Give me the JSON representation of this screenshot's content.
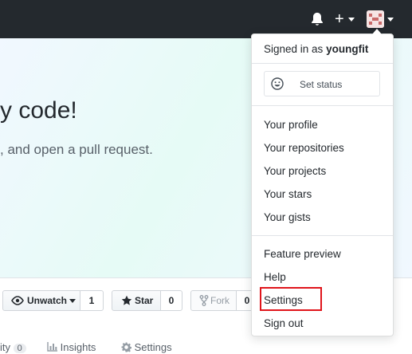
{
  "hero": {
    "heading": "y code!",
    "subtext": ", and open a pull request."
  },
  "repo_actions": {
    "unwatch_label": "Unwatch",
    "watch_count": "1",
    "star_label": "Star",
    "star_count": "0",
    "fork_label": "Fork",
    "fork_count": "0"
  },
  "repo_tabs": [
    {
      "label": "ity",
      "count": "0"
    },
    {
      "label": "Insights"
    },
    {
      "label": "Settings"
    }
  ],
  "user_menu": {
    "signed_in_prefix": "Signed in as",
    "username": "youngfit",
    "set_status": "Set status",
    "items_group1": [
      "Your profile",
      "Your repositories",
      "Your projects",
      "Your stars",
      "Your gists"
    ],
    "items_group2": [
      "Feature preview",
      "Help",
      "Settings",
      "Sign out"
    ]
  },
  "colors": {
    "header_bg": "#24292e",
    "highlight_box": "#e0151b"
  }
}
